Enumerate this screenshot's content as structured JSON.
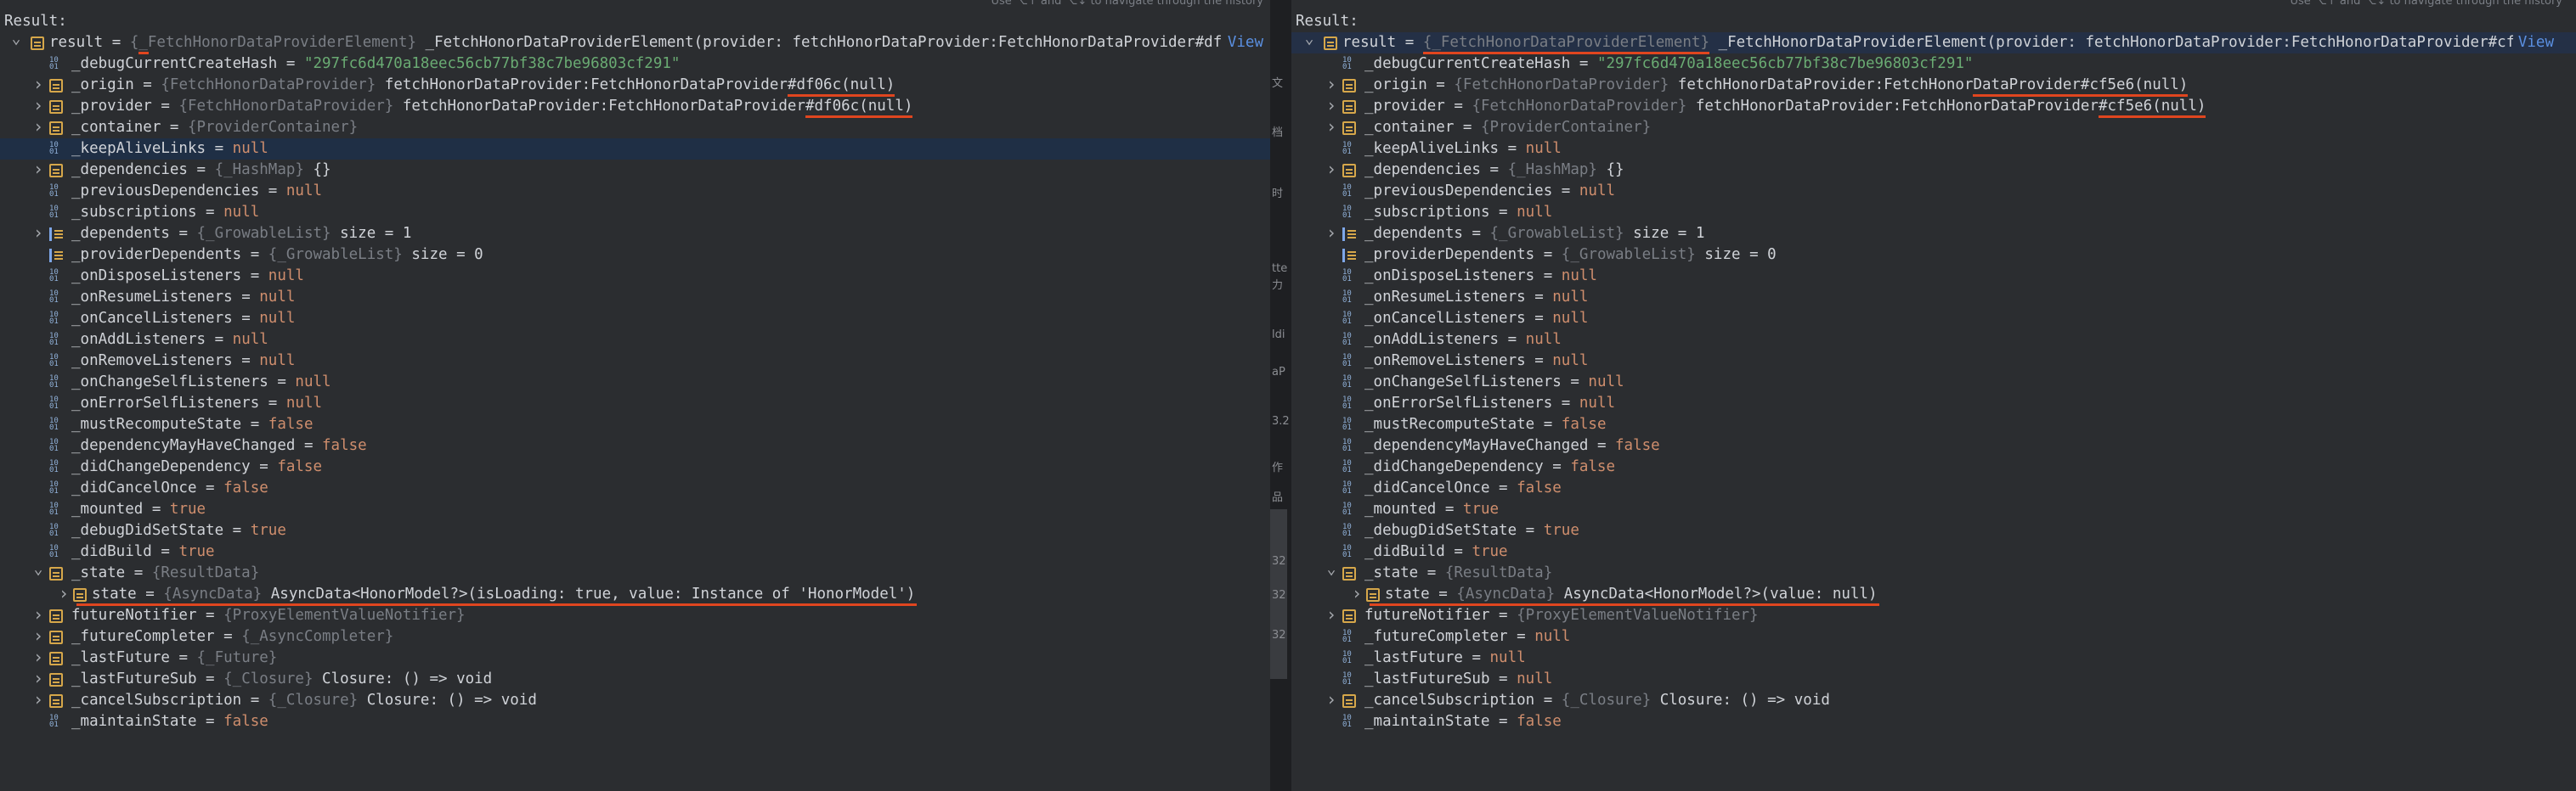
{
  "hint_text": "Use ⌥↑ and ⌥↓ to navigate through the history",
  "result_label": "Result:",
  "divider_ghost": [
    "文",
    "档",
    "时",
    "tte",
    "力",
    "ldi",
    "aP",
    "3.2",
    "作",
    "品",
    "32",
    "32",
    "32"
  ],
  "left": {
    "rows": [
      {
        "icon": "field",
        "arrow": "down",
        "depth": 0,
        "name": "result",
        "type": "{_FetchHonorDataProviderElement}",
        "value": "_FetchHonorDataProviderElement(provider: fetchHonorDataProvider:FetchHonorDataProvider#df...",
        "link": "View"
      },
      {
        "icon": "prim",
        "depth": 1,
        "name": "_debugCurrentCreateHash",
        "value_str": "\"297fc6d470a18eec56cb77bf38c7be96803cf291\""
      },
      {
        "icon": "field",
        "arrow": "right",
        "depth": 1,
        "name": "_origin",
        "type": "{FetchHonorDataProvider}",
        "value": "fetchHonorDataProvider:FetchHonorDataProvider#df06c(null)"
      },
      {
        "icon": "field",
        "arrow": "right",
        "depth": 1,
        "name": "_provider",
        "type": "{FetchHonorDataProvider}",
        "value": "fetchHonorDataProvider:FetchHonorDataProvider#df06c(null)"
      },
      {
        "icon": "field",
        "arrow": "right",
        "depth": 1,
        "name": "_container",
        "type": "{ProviderContainer}"
      },
      {
        "icon": "prim",
        "depth": 1,
        "name": "_keepAliveLinks",
        "value_kw": "null",
        "selected": true
      },
      {
        "icon": "field",
        "arrow": "right",
        "depth": 1,
        "name": "_dependencies",
        "type": "{_HashMap}",
        "value": "{}"
      },
      {
        "icon": "prim",
        "depth": 1,
        "name": "_previousDependencies",
        "value_kw": "null"
      },
      {
        "icon": "prim",
        "depth": 1,
        "name": "_subscriptions",
        "value_kw": "null"
      },
      {
        "icon": "list",
        "arrow": "right",
        "depth": 1,
        "name": "_dependents",
        "type": "{_GrowableList}",
        "value": "size = 1"
      },
      {
        "icon": "list",
        "depth": 1,
        "name": "_providerDependents",
        "type": "{_GrowableList}",
        "value": "size = 0"
      },
      {
        "icon": "prim",
        "depth": 1,
        "name": "_onDisposeListeners",
        "value_kw": "null"
      },
      {
        "icon": "prim",
        "depth": 1,
        "name": "_onResumeListeners",
        "value_kw": "null"
      },
      {
        "icon": "prim",
        "depth": 1,
        "name": "_onCancelListeners",
        "value_kw": "null"
      },
      {
        "icon": "prim",
        "depth": 1,
        "name": "_onAddListeners",
        "value_kw": "null"
      },
      {
        "icon": "prim",
        "depth": 1,
        "name": "_onRemoveListeners",
        "value_kw": "null"
      },
      {
        "icon": "prim",
        "depth": 1,
        "name": "_onChangeSelfListeners",
        "value_kw": "null"
      },
      {
        "icon": "prim",
        "depth": 1,
        "name": "_onErrorSelfListeners",
        "value_kw": "null"
      },
      {
        "icon": "prim",
        "depth": 1,
        "name": "_mustRecomputeState",
        "value_kw": "false"
      },
      {
        "icon": "prim",
        "depth": 1,
        "name": "_dependencyMayHaveChanged",
        "value_kw": "false"
      },
      {
        "icon": "prim",
        "depth": 1,
        "name": "_didChangeDependency",
        "value_kw": "false"
      },
      {
        "icon": "prim",
        "depth": 1,
        "name": "_didCancelOnce",
        "value_kw": "false"
      },
      {
        "icon": "prim",
        "depth": 1,
        "name": "_mounted",
        "value_kw": "true"
      },
      {
        "icon": "prim",
        "depth": 1,
        "name": "_debugDidSetState",
        "value_kw": "true"
      },
      {
        "icon": "prim",
        "depth": 1,
        "name": "_didBuild",
        "value_kw": "true"
      },
      {
        "icon": "field",
        "arrow": "down",
        "depth": 1,
        "name": "_state",
        "type": "{ResultData}"
      },
      {
        "icon": "field",
        "arrow": "right",
        "depth": 2,
        "name": "state",
        "type": "{AsyncData}",
        "value": "AsyncData<HonorModel?>(isLoading: true, value: Instance of 'HonorModel')"
      },
      {
        "icon": "field",
        "arrow": "right",
        "depth": 1,
        "name": "futureNotifier",
        "type": "{ProxyElementValueNotifier}"
      },
      {
        "icon": "field",
        "arrow": "right",
        "depth": 1,
        "name": "_futureCompleter",
        "type": "{_AsyncCompleter}"
      },
      {
        "icon": "field",
        "arrow": "right",
        "depth": 1,
        "name": "_lastFuture",
        "type": "{_Future}"
      },
      {
        "icon": "field",
        "arrow": "right",
        "depth": 1,
        "name": "_lastFutureSub",
        "type": "{_Closure}",
        "value": "Closure: () => void"
      },
      {
        "icon": "field",
        "arrow": "right",
        "depth": 1,
        "name": "_cancelSubscription",
        "type": "{_Closure}",
        "value": "Closure: () => void"
      },
      {
        "icon": "prim",
        "depth": 1,
        "name": "_maintainState",
        "value_kw": "false"
      }
    ]
  },
  "right": {
    "rows": [
      {
        "icon": "field",
        "arrow": "down",
        "depth": 0,
        "name": "result",
        "type": "{_FetchHonorDataProviderElement}",
        "value": "_FetchHonorDataProviderElement(provider: fetchHonorDataProvider:FetchHonorDataProvider#cf...",
        "link": "View",
        "selected": true
      },
      {
        "icon": "prim",
        "depth": 1,
        "name": "_debugCurrentCreateHash",
        "value_str": "\"297fc6d470a18eec56cb77bf38c7be96803cf291\""
      },
      {
        "icon": "field",
        "arrow": "right",
        "depth": 1,
        "name": "_origin",
        "type": "{FetchHonorDataProvider}",
        "value": "fetchHonorDataProvider:FetchHonorDataProvider#cf5e6(null)"
      },
      {
        "icon": "field",
        "arrow": "right",
        "depth": 1,
        "name": "_provider",
        "type": "{FetchHonorDataProvider}",
        "value": "fetchHonorDataProvider:FetchHonorDataProvider#cf5e6(null)"
      },
      {
        "icon": "field",
        "arrow": "right",
        "depth": 1,
        "name": "_container",
        "type": "{ProviderContainer}"
      },
      {
        "icon": "prim",
        "depth": 1,
        "name": "_keepAliveLinks",
        "value_kw": "null"
      },
      {
        "icon": "field",
        "arrow": "right",
        "depth": 1,
        "name": "_dependencies",
        "type": "{_HashMap}",
        "value": "{}"
      },
      {
        "icon": "prim",
        "depth": 1,
        "name": "_previousDependencies",
        "value_kw": "null"
      },
      {
        "icon": "prim",
        "depth": 1,
        "name": "_subscriptions",
        "value_kw": "null"
      },
      {
        "icon": "list",
        "arrow": "right",
        "depth": 1,
        "name": "_dependents",
        "type": "{_GrowableList}",
        "value": "size = 1"
      },
      {
        "icon": "list",
        "depth": 1,
        "name": "_providerDependents",
        "type": "{_GrowableList}",
        "value": "size = 0"
      },
      {
        "icon": "prim",
        "depth": 1,
        "name": "_onDisposeListeners",
        "value_kw": "null"
      },
      {
        "icon": "prim",
        "depth": 1,
        "name": "_onResumeListeners",
        "value_kw": "null"
      },
      {
        "icon": "prim",
        "depth": 1,
        "name": "_onCancelListeners",
        "value_kw": "null"
      },
      {
        "icon": "prim",
        "depth": 1,
        "name": "_onAddListeners",
        "value_kw": "null"
      },
      {
        "icon": "prim",
        "depth": 1,
        "name": "_onRemoveListeners",
        "value_kw": "null"
      },
      {
        "icon": "prim",
        "depth": 1,
        "name": "_onChangeSelfListeners",
        "value_kw": "null"
      },
      {
        "icon": "prim",
        "depth": 1,
        "name": "_onErrorSelfListeners",
        "value_kw": "null"
      },
      {
        "icon": "prim",
        "depth": 1,
        "name": "_mustRecomputeState",
        "value_kw": "false"
      },
      {
        "icon": "prim",
        "depth": 1,
        "name": "_dependencyMayHaveChanged",
        "value_kw": "false"
      },
      {
        "icon": "prim",
        "depth": 1,
        "name": "_didChangeDependency",
        "value_kw": "false"
      },
      {
        "icon": "prim",
        "depth": 1,
        "name": "_didCancelOnce",
        "value_kw": "false"
      },
      {
        "icon": "prim",
        "depth": 1,
        "name": "_mounted",
        "value_kw": "true"
      },
      {
        "icon": "prim",
        "depth": 1,
        "name": "_debugDidSetState",
        "value_kw": "true"
      },
      {
        "icon": "prim",
        "depth": 1,
        "name": "_didBuild",
        "value_kw": "true"
      },
      {
        "icon": "field",
        "arrow": "down",
        "depth": 1,
        "name": "_state",
        "type": "{ResultData}"
      },
      {
        "icon": "field",
        "arrow": "right",
        "depth": 2,
        "name": "state",
        "type": "{AsyncData}",
        "value": "AsyncData<HonorModel?>(value: null)"
      },
      {
        "icon": "field",
        "arrow": "right",
        "depth": 1,
        "name": "futureNotifier",
        "type": "{ProxyElementValueNotifier}"
      },
      {
        "icon": "prim",
        "depth": 1,
        "name": "_futureCompleter",
        "value_kw": "null"
      },
      {
        "icon": "prim",
        "depth": 1,
        "name": "_lastFuture",
        "value_kw": "null"
      },
      {
        "icon": "prim",
        "depth": 1,
        "name": "_lastFutureSub",
        "value_kw": "null"
      },
      {
        "icon": "field",
        "arrow": "right",
        "depth": 1,
        "name": "_cancelSubscription",
        "type": "{_Closure}",
        "value": "Closure: () => void"
      },
      {
        "icon": "prim",
        "depth": 1,
        "name": "_maintainState",
        "value_kw": "false"
      }
    ]
  },
  "icons": {
    "arrow_down": "chevron-down-icon",
    "arrow_right": "chevron-right-icon",
    "field": "field-icon",
    "list": "list-icon",
    "prim": "primitive-icon"
  },
  "colors": {
    "background": "#2b2d30",
    "selection": "#214283",
    "keyword": "#cf8e6d",
    "string": "#6aab73",
    "type_hint": "#7a7e85",
    "link": "#5a8fe0",
    "annotation_underline": "#e0461f"
  }
}
